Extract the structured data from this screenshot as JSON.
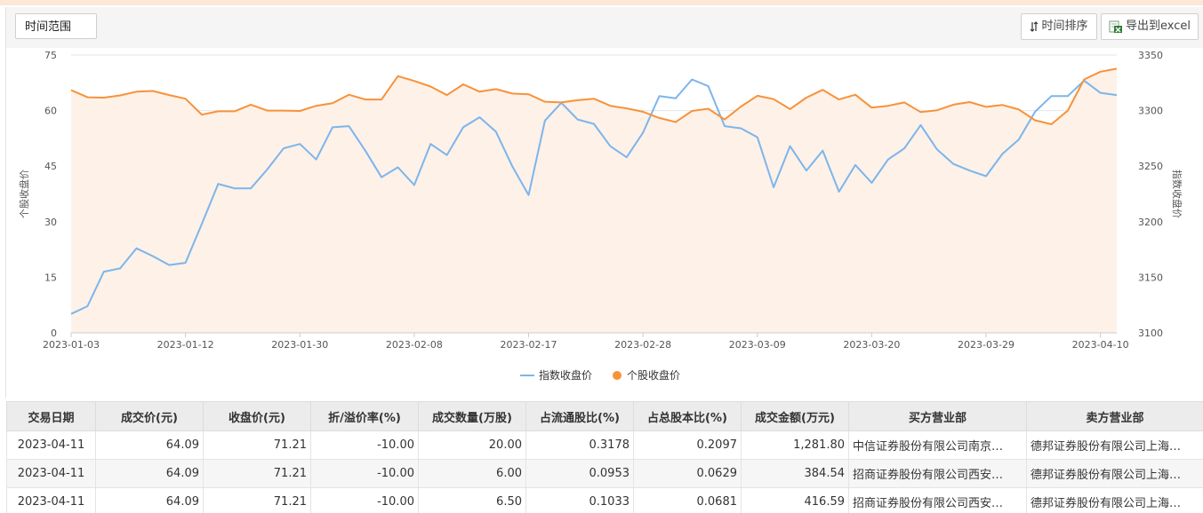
{
  "toolbar": {
    "range_label": "时间范围",
    "sort_label": "时间排序",
    "export_label": "导出到excel"
  },
  "chart_data": {
    "type": "line",
    "ylabel_left": "个股收盘价",
    "ylabel_right": "指数收盘价",
    "ylim_left": [
      0,
      75
    ],
    "ylim_right": [
      3100,
      3350
    ],
    "yticks_left": [
      0,
      15,
      30,
      45,
      60,
      75
    ],
    "yticks_right": [
      3100,
      3150,
      3200,
      3250,
      3300,
      3350
    ],
    "grid": true,
    "legend": "bottom-center",
    "x_tick_labels": [
      "2023-01-03",
      "2023-01-12",
      "2023-01-30",
      "2023-02-08",
      "2023-02-17",
      "2023-02-28",
      "2023-03-09",
      "2023-03-20",
      "2023-03-29",
      "2023-04-10"
    ],
    "x_tick_indices": [
      0,
      7,
      14,
      21,
      28,
      35,
      42,
      49,
      56,
      63
    ],
    "series": [
      {
        "name": "指数收盘价",
        "color": "#7cb5ec",
        "axis": "right",
        "values": [
          3117,
          3124,
          3155,
          3158,
          3176,
          3169,
          3161,
          3163,
          3198,
          3234,
          3230,
          3230,
          3247,
          3266,
          3270,
          3256,
          3285,
          3286,
          3264,
          3240,
          3249,
          3233,
          3270,
          3260,
          3285,
          3294,
          3281,
          3250,
          3224,
          3291,
          3307,
          3292,
          3288,
          3268,
          3258,
          3280,
          3313,
          3311,
          3328,
          3322,
          3286,
          3284,
          3276,
          3231,
          3268,
          3246,
          3264,
          3227,
          3251,
          3235,
          3256,
          3266,
          3287,
          3265,
          3252,
          3246,
          3241,
          3261,
          3274,
          3299,
          3313,
          3313,
          3327,
          3316,
          3314
        ]
      },
      {
        "name": "个股收盘价",
        "color": "#f7923a",
        "axis": "left",
        "fill": "#fdf1e8",
        "values": [
          65.5,
          63.6,
          63.5,
          64.1,
          65.1,
          65.3,
          64.2,
          63.2,
          58.9,
          59.8,
          59.8,
          61.6,
          60.0,
          60.0,
          59.9,
          61.3,
          62.0,
          64.3,
          63.0,
          63.0,
          69.3,
          68.0,
          66.5,
          64.2,
          67.1,
          65.1,
          65.8,
          64.6,
          64.4,
          62.4,
          62.2,
          62.8,
          63.2,
          61.3,
          60.6,
          59.7,
          58.0,
          56.9,
          59.9,
          60.5,
          57.6,
          61.1,
          64.0,
          63.1,
          60.4,
          63.5,
          65.6,
          63.0,
          64.3,
          60.8,
          61.3,
          62.2,
          59.6,
          60.1,
          61.6,
          62.3,
          61.0,
          61.5,
          60.3,
          57.4,
          56.3,
          60.0,
          68.4,
          70.5,
          71.3
        ]
      }
    ]
  },
  "table": {
    "headers": [
      "交易日期",
      "成交价(元)",
      "收盘价(元)",
      "折/溢价率(%)",
      "成交数量(万股)",
      "占流通股比(%)",
      "占总股本比(%)",
      "成交金额(万元)",
      "买方营业部",
      "卖方营业部"
    ],
    "rows": [
      [
        "2023-04-11",
        "64.09",
        "71.21",
        "-10.00",
        "20.00",
        "0.3178",
        "0.2097",
        "1,281.80",
        "中信证券股份有限公司南京…",
        "德邦证券股份有限公司上海…"
      ],
      [
        "2023-04-11",
        "64.09",
        "71.21",
        "-10.00",
        "6.00",
        "0.0953",
        "0.0629",
        "384.54",
        "招商证券股份有限公司西安…",
        "德邦证券股份有限公司上海…"
      ],
      [
        "2023-04-11",
        "64.09",
        "71.21",
        "-10.00",
        "6.50",
        "0.1033",
        "0.0681",
        "416.59",
        "招商证券股份有限公司西安…",
        "德邦证券股份有限公司上海…"
      ]
    ]
  }
}
